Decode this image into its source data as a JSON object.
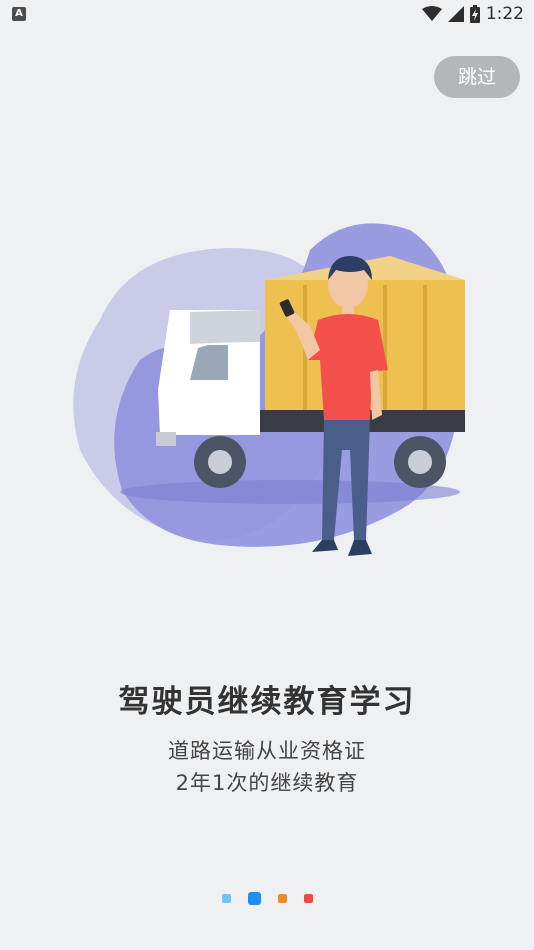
{
  "status_bar": {
    "left_icon_letter": "A",
    "time": "1:22",
    "icons": [
      "wifi-icon",
      "signal-icon",
      "battery-charging-icon"
    ]
  },
  "skip_button": {
    "label": "跳过"
  },
  "illustration": {
    "description_icons": [
      "truck",
      "person-with-phone"
    ],
    "colors": {
      "blob_light": "#c9cbe9",
      "blob_dark": "#8f92de",
      "truck_cargo": "#eec050",
      "truck_cab": "#ffffff",
      "shirt": "#f4504b",
      "jeans": "#4a5e8a"
    }
  },
  "onboarding": {
    "title": "驾驶员继续教育学习",
    "subtitle_line1": "道路运输从业资格证",
    "subtitle_line2": "2年1次的继续教育"
  },
  "pager": {
    "current_index": 1,
    "dot_colors": [
      "#6ec3f7",
      "#1e8ef2",
      "#f58a2a",
      "#ef4a44"
    ]
  }
}
